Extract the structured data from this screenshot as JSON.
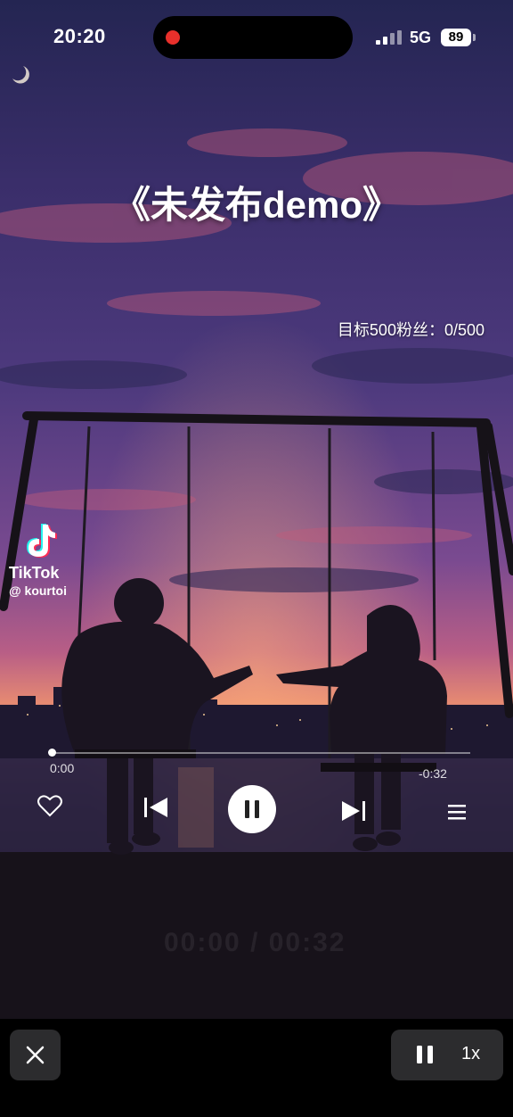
{
  "status_bar": {
    "time": "20:20",
    "network": "5G",
    "battery": "89"
  },
  "video": {
    "title": "《未发布demo》",
    "goal_text": "目标500粉丝：0/500",
    "tiktok_brand": "TikTok",
    "tiktok_handle": "@ kourtoi",
    "watermark": "00:00 / 00:32"
  },
  "player": {
    "elapsed": "0:00",
    "remaining": "-0:32",
    "progress": 0.0
  },
  "controls": {
    "speed_label": "1x"
  },
  "icons": {
    "like": "heart-icon",
    "previous": "skip-previous-icon",
    "play_pause": "pause-icon",
    "next": "skip-next-icon",
    "playlist": "menu-icon",
    "close": "close-icon",
    "pip_pause": "pause-icon"
  },
  "colors": {
    "recording": "#e8302b",
    "sky_top": "#2a2a5e",
    "sky_mid": "#6b3f8e",
    "horizon": "#e08a7a",
    "water": "#2a2240",
    "button_bg": "#2c2c2e"
  }
}
